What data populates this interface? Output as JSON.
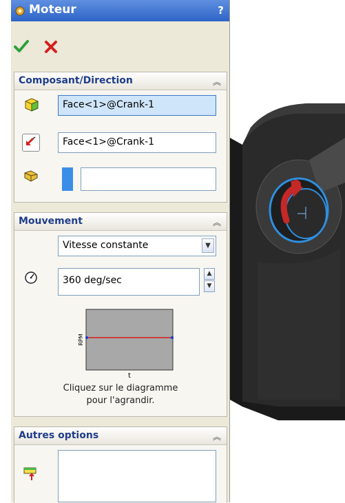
{
  "panel": {
    "title": "Moteur",
    "help_label": "?",
    "ok_icon": "check-icon",
    "cancel_icon": "close-icon"
  },
  "component_direction": {
    "header": "Composant/Direction",
    "component_value": "Face<1>@Crank-1",
    "direction_value": "Face<1>@Crank-1",
    "relative_value": ""
  },
  "motion": {
    "header": "Mouvement",
    "type_selected": "Vitesse constante",
    "speed_value": "360 deg/sec",
    "graph": {
      "ylabel": "RPM",
      "xlabel": "t"
    },
    "caption_line1": "Cliquez sur le diagramme",
    "caption_line2": "pour l'agrandir."
  },
  "other_options": {
    "header": "Autres options",
    "value": ""
  },
  "colors": {
    "title_bar": "#2e64c7",
    "selection_field": "#cfe6fa",
    "rotation_arrow": "#c62828",
    "highlight_edge": "#2f8fe0"
  }
}
